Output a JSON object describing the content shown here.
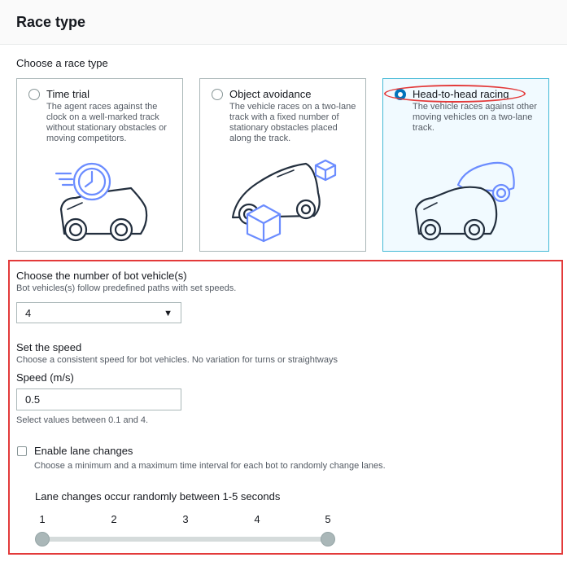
{
  "header": {
    "title": "Race type"
  },
  "race_type": {
    "label": "Choose a race type",
    "options": [
      {
        "title": "Time trial",
        "description": "The agent races against the clock on a well-marked track without stationary obstacles or moving competitors.",
        "icon": "clock-car-icon",
        "selected": false
      },
      {
        "title": "Object avoidance",
        "description": "The vehicle races on a two-lane track with a fixed number of stationary obstacles placed along the track.",
        "icon": "car-boxes-icon",
        "selected": false
      },
      {
        "title": "Head-to-head racing",
        "description": "The vehicle races against other moving vehicles on a two-lane track.",
        "icon": "two-cars-icon",
        "selected": true
      }
    ]
  },
  "bots": {
    "title": "Choose the number of bot vehicle(s)",
    "description": "Bot vehicles(s) follow predefined paths with set speeds.",
    "selected_value": "4"
  },
  "speed": {
    "title": "Set the speed",
    "description": "Choose a consistent speed for bot vehicles. No variation for turns or straightways",
    "field_label": "Speed (m/s)",
    "value": "0.5",
    "hint": "Select values between 0.1 and 4."
  },
  "lane_changes": {
    "label": "Enable lane changes",
    "description": "Choose a minimum and a maximum time interval for each bot to randomly change lanes.",
    "checked": false,
    "range_title": "Lane changes occur randomly between 1-5 seconds",
    "ticks": [
      "1",
      "2",
      "3",
      "4",
      "5"
    ],
    "range_min": 1,
    "range_max": 5
  },
  "colors": {
    "accent": "#0073bb",
    "highlight": "#e33a3a",
    "illustration": "#6b8cff"
  }
}
